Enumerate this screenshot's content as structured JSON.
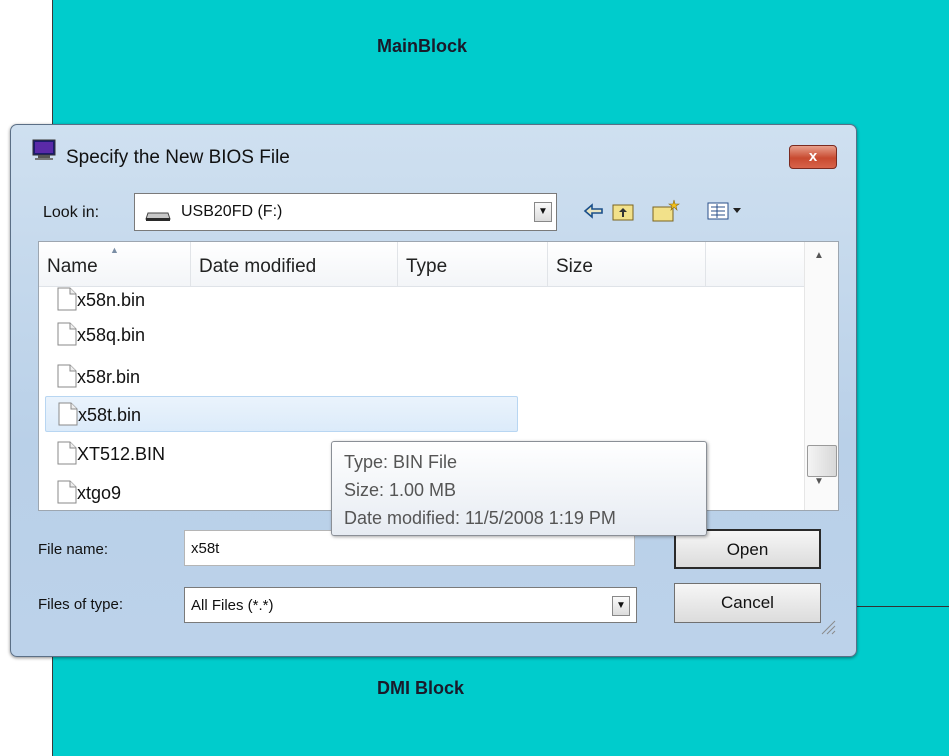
{
  "background": {
    "main_block_label": "MainBlock",
    "dmi_block_label": "DMI Block",
    "color": "#00cccc"
  },
  "dialog": {
    "title": "Specify the New BIOS File",
    "close_label": "x",
    "look_in": {
      "label": "Look in:",
      "value": "USB20FD (F:)",
      "icon": "drive-icon"
    },
    "toolbar": {
      "back_icon": "back-arrow-icon",
      "up_icon": "up-folder-icon",
      "new_folder_icon": "new-folder-icon",
      "view_icon": "view-menu-icon"
    },
    "columns": [
      "Name",
      "Date modified",
      "Type",
      "Size"
    ],
    "files": [
      {
        "name": "x58n.bin",
        "selected": false
      },
      {
        "name": "x58q.bin",
        "selected": false
      },
      {
        "name": "x58r.bin",
        "selected": false
      },
      {
        "name": "x58t.bin",
        "selected": true
      },
      {
        "name": "XT512.BIN",
        "selected": false
      },
      {
        "name": "xtgo9",
        "selected": false
      }
    ],
    "tooltip": {
      "type": "Type: BIN File",
      "size": "Size: 1.00 MB",
      "date": "Date modified: 11/5/2008 1:19 PM"
    },
    "file_name": {
      "label": "File name:",
      "value": "x58t"
    },
    "file_type": {
      "label": "Files of type:",
      "value": "All Files (*.*)"
    },
    "buttons": {
      "open": "Open",
      "cancel": "Cancel"
    }
  }
}
